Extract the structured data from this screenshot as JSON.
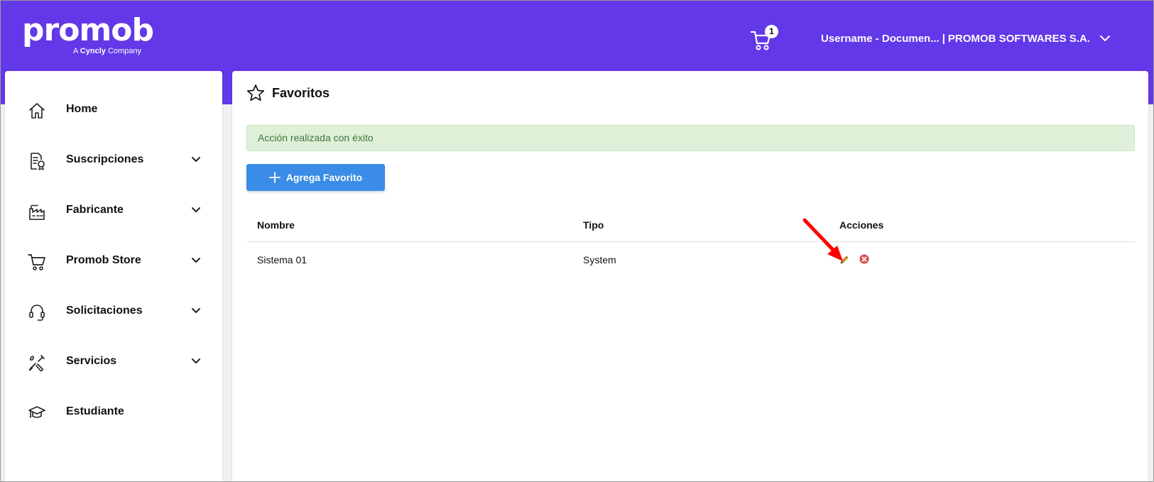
{
  "header": {
    "logo_text": "promob",
    "logo_tag_prefix": "A",
    "logo_tag_brand": "Cyncly",
    "logo_tag_suffix": "Company",
    "cart_count": "1",
    "user_label": "Username - Documen...",
    "separator": "|",
    "company": "PROMOB SOFTWARES S.A."
  },
  "sidebar": {
    "items": [
      {
        "label": "Home",
        "icon": "home-icon",
        "has_children": false
      },
      {
        "label": "Suscripciones",
        "icon": "subscription-document-icon",
        "has_children": true
      },
      {
        "label": "Fabricante",
        "icon": "factory-icon",
        "has_children": true
      },
      {
        "label": "Promob Store",
        "icon": "shopping-cart-icon",
        "has_children": true
      },
      {
        "label": "Solicitaciones",
        "icon": "headset-icon",
        "has_children": true
      },
      {
        "label": "Servicios",
        "icon": "tools-icon",
        "has_children": true
      },
      {
        "label": "Estudiante",
        "icon": "graduation-cap-icon",
        "has_children": false
      }
    ]
  },
  "main": {
    "title": "Favoritos",
    "alert": "Acción realizada con éxito",
    "add_button": "Agrega Favorito",
    "table": {
      "columns": [
        "Nombre",
        "Tipo",
        "Acciones"
      ],
      "rows": [
        {
          "nombre": "Sistema 01",
          "tipo": "System"
        }
      ]
    }
  },
  "colors": {
    "header_bg": "#6238e8",
    "button_bg": "#3a8ce6",
    "alert_bg": "#dff0d8",
    "alert_text": "#3c763d",
    "annotation_arrow": "#ff0000"
  }
}
